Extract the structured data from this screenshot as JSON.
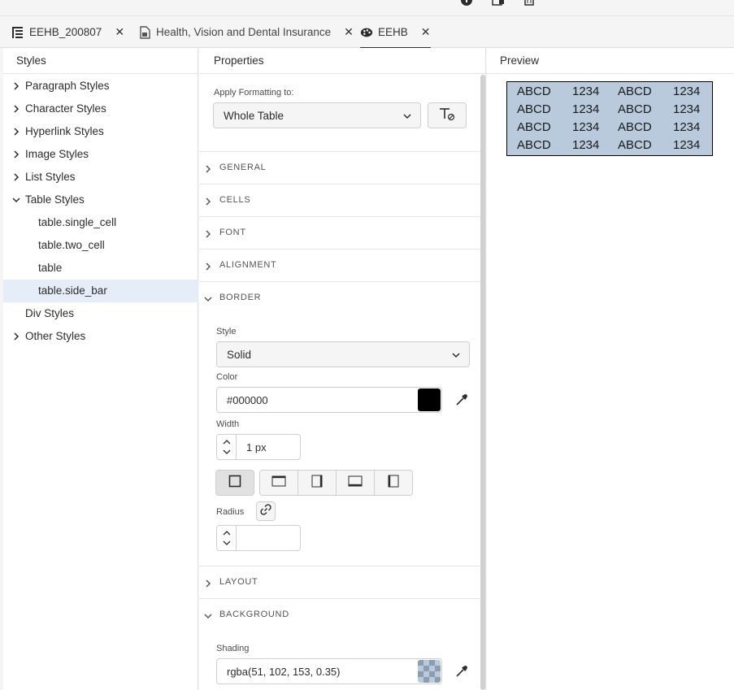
{
  "tabs": [
    {
      "label": "EEHB_200807",
      "icon": "document-outline-icon",
      "active": false
    },
    {
      "label": "Health, Vision and Dental Insurance",
      "icon": "document-file-icon",
      "active": false
    },
    {
      "label": "EEHB",
      "icon": "palette-icon",
      "active": true
    }
  ],
  "styles_panel": {
    "title": "Styles",
    "items": [
      {
        "label": "Paragraph Styles",
        "expanded": false
      },
      {
        "label": "Character Styles",
        "expanded": false
      },
      {
        "label": "Hyperlink Styles",
        "expanded": false
      },
      {
        "label": "Image Styles",
        "expanded": false
      },
      {
        "label": "List Styles",
        "expanded": false
      },
      {
        "label": "Table Styles",
        "expanded": true
      },
      {
        "label": "table.single_cell"
      },
      {
        "label": "table.two_cell"
      },
      {
        "label": "table"
      },
      {
        "label": "table.side_bar",
        "selected": true
      },
      {
        "label": "Div Styles"
      },
      {
        "label": "Other Styles",
        "expanded": false
      }
    ]
  },
  "properties": {
    "title": "Properties",
    "apply_label": "Apply Formatting to:",
    "apply_value": "Whole Table",
    "sections": {
      "general": "GENERAL",
      "cells": "CELLS",
      "font": "FONT",
      "alignment": "ALIGNMENT",
      "border": "BORDER",
      "layout": "LAYOUT",
      "background": "BACKGROUND"
    },
    "border": {
      "style_label": "Style",
      "style_value": "Solid",
      "color_label": "Color",
      "color_value": "#000000",
      "width_label": "Width",
      "width_value": "1 px",
      "radius_label": "Radius",
      "radius_value": ""
    },
    "background": {
      "shading_label": "Shading",
      "shading_value": "rgba(51, 102, 153, 0.35)"
    }
  },
  "preview": {
    "title": "Preview",
    "rows": [
      [
        "ABCD",
        "1234",
        "ABCD",
        "1234"
      ],
      [
        "ABCD",
        "1234",
        "ABCD",
        "1234"
      ],
      [
        "ABCD",
        "1234",
        "ABCD",
        "1234"
      ],
      [
        "ABCD",
        "1234",
        "ABCD",
        "1234"
      ]
    ]
  },
  "colors": {
    "selected_bg": "#e5edf9",
    "border_color": "#000000",
    "shading": "rgba(51,102,153,0.35)"
  }
}
